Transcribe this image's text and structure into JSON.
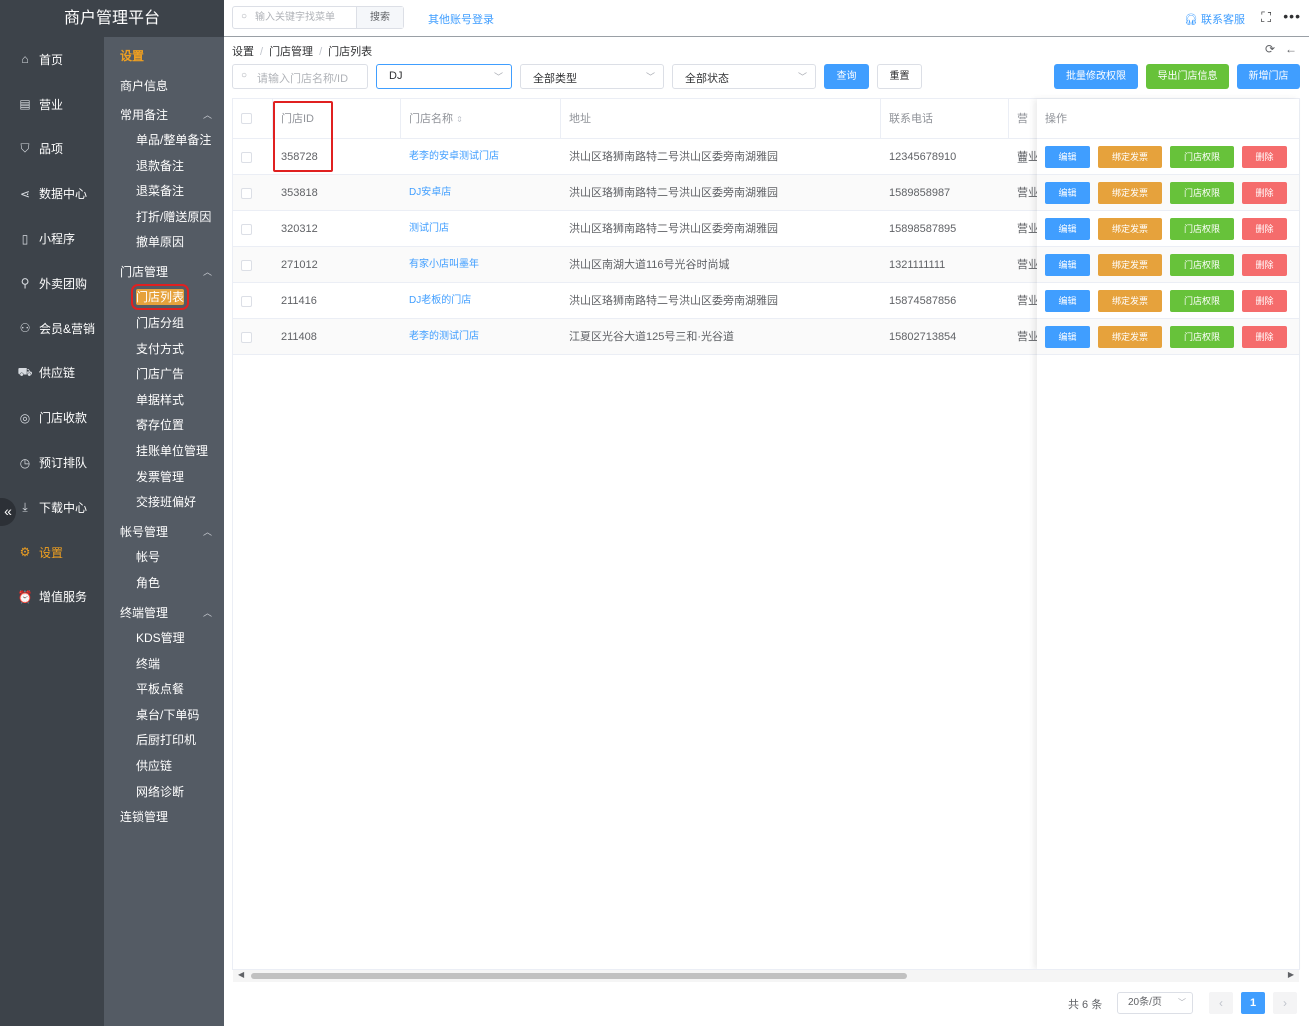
{
  "app_title": "商户管理平台",
  "topbar": {
    "search_placeholder": "输入关键字找菜单",
    "search_button": "搜索",
    "other_login": "其他账号登录",
    "contact": "联系客服"
  },
  "nav_primary": [
    {
      "label": "首页",
      "icon": "home-icon"
    },
    {
      "label": "营业",
      "icon": "calendar-icon"
    },
    {
      "label": "品项",
      "icon": "bag-icon"
    },
    {
      "label": "数据中心",
      "icon": "share-icon"
    },
    {
      "label": "小程序",
      "icon": "phone-icon"
    },
    {
      "label": "外卖团购",
      "icon": "bike-icon"
    },
    {
      "label": "会员&营销",
      "icon": "user-icon"
    },
    {
      "label": "供应链",
      "icon": "truck-icon"
    },
    {
      "label": "门店收款",
      "icon": "coins-icon"
    },
    {
      "label": "预订排队",
      "icon": "clock-icon"
    },
    {
      "label": "下载中心",
      "icon": "download-icon"
    },
    {
      "label": "设置",
      "icon": "gear-icon"
    },
    {
      "label": "增值服务",
      "icon": "alarm-icon"
    }
  ],
  "nav_secondary": {
    "top": "设置",
    "merchant_info": "商户信息",
    "groups": [
      {
        "label": "常用备注",
        "items": [
          "单品/整单备注",
          "退款备注",
          "退菜备注",
          "打折/赠送原因",
          "撤单原因"
        ]
      },
      {
        "label": "门店管理",
        "items": [
          "门店列表",
          "门店分组",
          "支付方式",
          "门店广告",
          "单据样式",
          "寄存位置",
          "挂账单位管理",
          "发票管理",
          "交接班偏好"
        ]
      },
      {
        "label": "帐号管理",
        "items": [
          "帐号",
          "角色"
        ]
      },
      {
        "label": "终端管理",
        "items": [
          "KDS管理",
          "终端",
          "平板点餐",
          "桌台/下单码",
          "后厨打印机",
          "供应链",
          "网络诊断"
        ]
      }
    ],
    "chain": "连锁管理",
    "active_item": "门店列表"
  },
  "breadcrumb": [
    "设置",
    "门店管理",
    "门店列表"
  ],
  "filters": {
    "store_placeholder": "请输入门店名称/ID",
    "keyword_value": "DJ",
    "type_value": "全部类型",
    "status_value": "全部状态",
    "query": "查询",
    "reset": "重置"
  },
  "actions": {
    "batch_perm": "批量修改权限",
    "export": "导出门店信息",
    "add": "新增门店"
  },
  "table": {
    "headers": {
      "id": "门店ID",
      "name": "门店名称",
      "address": "地址",
      "phone": "联系电话",
      "biz": "营业",
      "ops": "操作"
    },
    "rows": [
      {
        "id": "358728",
        "name": "老李的安卓测试门店",
        "address": "洪山区珞狮南路特二号洪山区委旁南湖雅园",
        "phone": "12345678910",
        "biz": "营业"
      },
      {
        "id": "353818",
        "name": "DJ安卓店",
        "address": "洪山区珞狮南路特二号洪山区委旁南湖雅园",
        "phone": "1589858987",
        "biz": "营业"
      },
      {
        "id": "320312",
        "name": "测试门店",
        "address": "洪山区珞狮南路特二号洪山区委旁南湖雅园",
        "phone": "15898587895",
        "biz": "营业"
      },
      {
        "id": "271012",
        "name": "有家小店叫墨年",
        "address": "洪山区南湖大道116号光谷时尚城",
        "phone": "1321111111",
        "biz": "营业"
      },
      {
        "id": "211416",
        "name": "DJ老板的门店",
        "address": "洪山区珞狮南路特二号洪山区委旁南湖雅园",
        "phone": "15874587856",
        "biz": "营业"
      },
      {
        "id": "211408",
        "name": "老李的测试门店",
        "address": "江夏区光谷大道125号三和·光谷道",
        "phone": "15802713854",
        "biz": "营业"
      }
    ],
    "op_labels": {
      "edit": "编辑",
      "invoice": "绑定发票",
      "perm": "门店权限",
      "delete": "删除"
    }
  },
  "pagination": {
    "total": "共 6 条",
    "page_size": "20条/页",
    "current": "1"
  },
  "colors": {
    "primary": "#409eff",
    "warning": "#e6a23c",
    "success": "#67c23a",
    "danger": "#f56c6c",
    "sidebar": "#3d434a"
  }
}
